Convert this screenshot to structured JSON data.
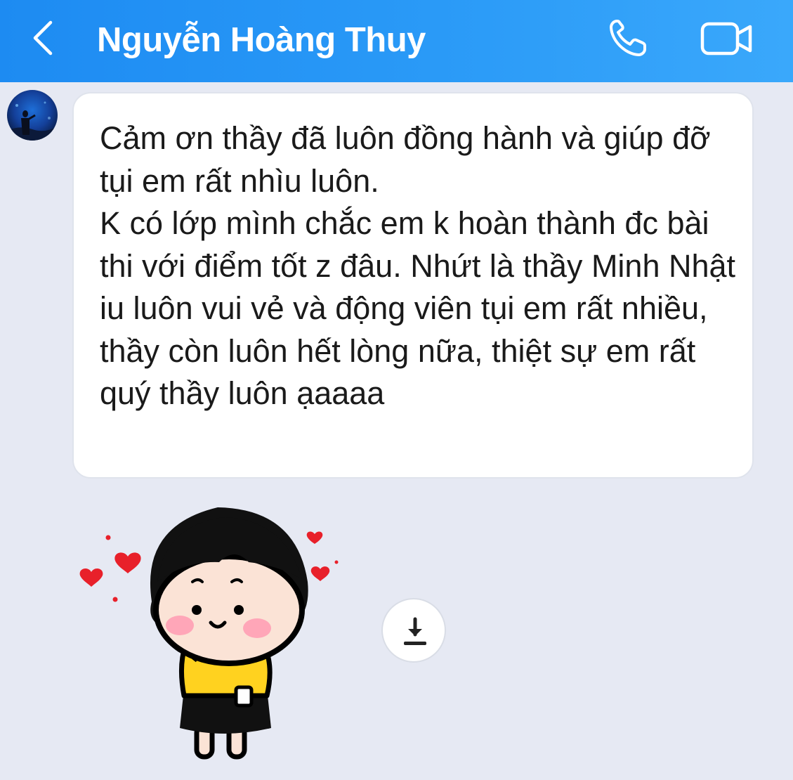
{
  "header": {
    "contact_name": "Nguyễn Hoàng Thuy",
    "icons": {
      "back": "chevron-left-icon",
      "call": "phone-icon",
      "video": "video-camera-icon"
    },
    "background_color": "#1d8bf2"
  },
  "messages": [
    {
      "sender": "Nguyễn Hoàng Thuy",
      "type": "text",
      "text": "Cảm ơn thầy đã luôn đồng hành và giúp đỡ tụi em rất nhìu luôn.\nK có lớp mình chắc em k hoàn thành đc bài thi với điểm tốt z đâu. Nhứt là thầy Minh Nhật iu luôn vui vẻ và động viên tụi em rất nhiều, thầy còn luôn hết lòng nữa, thiệt sự em rất quý thầy luôn ạaaaa"
    },
    {
      "sender": "Nguyễn Hoàng Thuy",
      "type": "sticker",
      "sticker": "girl-with-hearts-sticker",
      "action_icon": "download-icon"
    }
  ],
  "colors": {
    "chat_background": "#e6e9f3",
    "bubble_background": "#ffffff",
    "text": "#1a1a1a"
  }
}
